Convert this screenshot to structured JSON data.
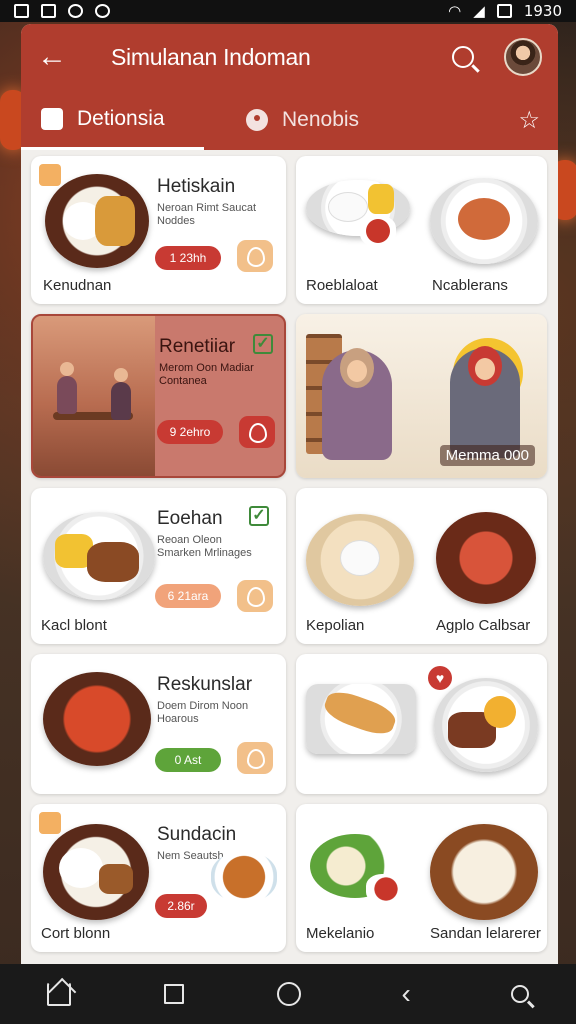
{
  "status_bar": {
    "time": "1930"
  },
  "app_bar": {
    "back_label": "←",
    "title": "Simulanan Indoman"
  },
  "tabs": [
    {
      "label": "Detionsia"
    },
    {
      "label": "Nenobis"
    }
  ],
  "cards": {
    "c1": {
      "title": "Hetiskain",
      "sub": "Neroan Rimt Saucat Noddes",
      "price": "1 23hh",
      "caption": "Kenudnan"
    },
    "c2": {
      "caption": "Roeblaloat"
    },
    "c3": {
      "caption": "Ncablerans"
    },
    "c4": {
      "title": "Renetiiar",
      "sub": "Merom Oon Madiar Contanea",
      "price": "9 2ehro"
    },
    "c5": {
      "caption": "Memma 000"
    },
    "c6": {
      "title": "Eoehan",
      "sub": "Reoan Oleon Smarken Mrlinages",
      "price": "6 21ara",
      "caption": "Kacl blont"
    },
    "c7": {
      "caption": "Kepolian"
    },
    "c8": {
      "caption": "Agplo Calbsar"
    },
    "c9": {
      "title": "Reskunslar",
      "sub": "Doem Dirom Noon Hoarous",
      "price": "0 Ast"
    },
    "c10": {
      "caption": ""
    },
    "c11": {
      "title": "Sundacin",
      "sub": "Nem Seautsh",
      "price": "2.86r",
      "caption": "Cort blonn"
    },
    "c12": {
      "caption": "Mekelanio"
    },
    "c13": {
      "caption": "Sandan lelarerer"
    }
  },
  "colors": {
    "accent": "#b03d2e",
    "price_red": "#c83a33",
    "price_orange": "#f1a37a",
    "price_green": "#5ea43a",
    "fav": "#f2c08a"
  },
  "icons": [
    "back-arrow-icon",
    "search-icon",
    "calendar-icon",
    "dish-icon",
    "star-icon",
    "home-icon",
    "square-icon",
    "circle-icon",
    "back-icon",
    "nav-search-icon"
  ]
}
